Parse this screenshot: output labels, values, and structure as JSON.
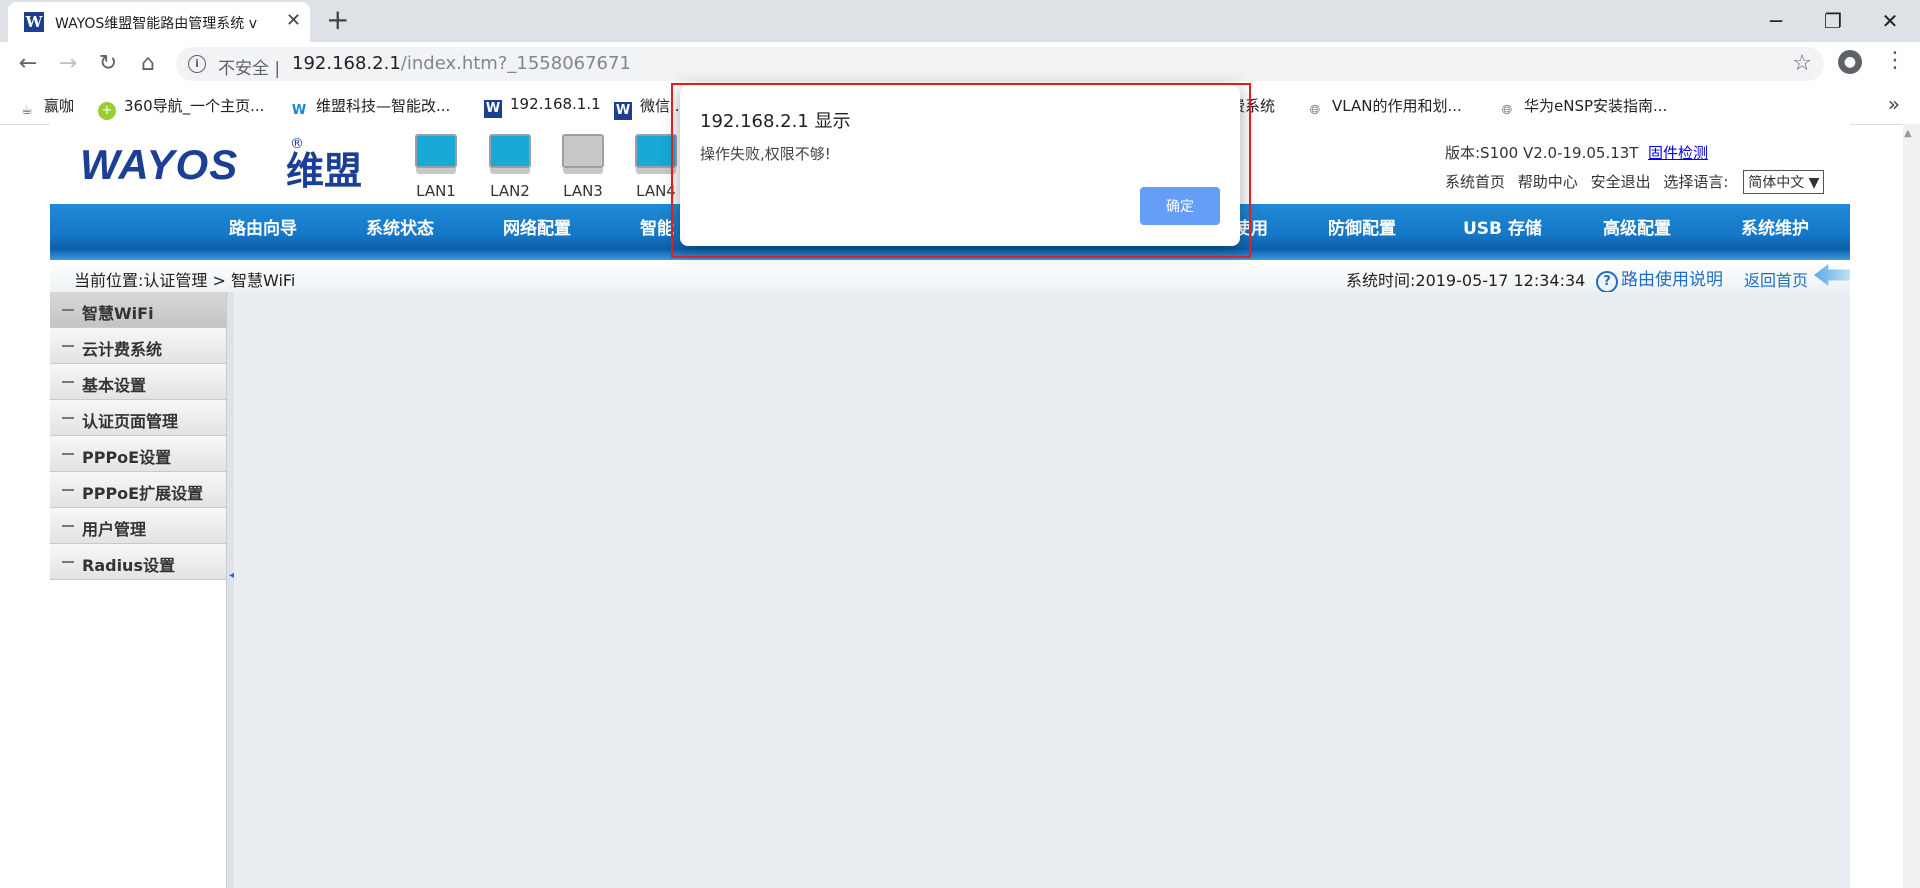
{
  "browser": {
    "tab_title": "WAYOS维盟智能路由管理系统 v",
    "tab_favicon": "W",
    "new_tab_symbol": "+",
    "close_symbol": "✕",
    "window_controls": {
      "minimize": "─",
      "maximize": "❐",
      "close": "✕"
    },
    "nav": {
      "back": "←",
      "forward": "→",
      "reload": "↻",
      "home": "⌂"
    },
    "security_label": "不安全",
    "url_host": "192.168.2.1",
    "url_path": "/index.htm?_1558067671",
    "bookmarks": [
      {
        "label": "赢咖",
        "icon": "coffee-icon"
      },
      {
        "label": "360导航_一个主页...",
        "icon": "360-icon"
      },
      {
        "label": "维盟科技—智能改...",
        "icon": "wayos-icon"
      },
      {
        "label": "192.168.1.1",
        "icon": "wayos-icon"
      },
      {
        "label": "微信...",
        "icon": "wayos-icon"
      },
      {
        "label": "费系统",
        "icon": "page-icon"
      },
      {
        "label": "VLAN的作用和划...",
        "icon": "globe-icon"
      },
      {
        "label": "华为eNSP安装指南...",
        "icon": "globe-icon"
      }
    ],
    "bookmarks_more": "»"
  },
  "header": {
    "logo_text": "WAYOS",
    "logo_cn": "维盟",
    "logo_reg": "®",
    "lan_ports": [
      {
        "label": "LAN1",
        "status": "active",
        "color": "#18a9d8"
      },
      {
        "label": "LAN2",
        "status": "active",
        "color": "#18a9d8"
      },
      {
        "label": "LAN3",
        "status": "inactive",
        "color": "#c8c8c8"
      },
      {
        "label": "LAN4",
        "status": "active",
        "color": "#18a9d8"
      }
    ],
    "version_label": "版本:S100 V2.0-19.05.13T",
    "firmware_check": "固件检测",
    "links": [
      "系统首页",
      "帮助中心",
      "安全退出",
      "选择语言:"
    ],
    "language": "简体中文 ▼"
  },
  "navbar": {
    "items": [
      "路由向导",
      "系统状态",
      "网络配置",
      "智能",
      "使用",
      "防御配置",
      "USB 存储",
      "高级配置",
      "系统维护"
    ]
  },
  "breadcrumb": {
    "text": "当前位置:认证管理 > 智慧WiFi",
    "system_time": "系统时间:2019-05-17 12:34:34",
    "help": "路由使用说明",
    "help_icon": "?",
    "home": "返回首页"
  },
  "sidebar": {
    "items": [
      {
        "label": "智慧WiFi",
        "active": true
      },
      {
        "label": "云计费系统",
        "active": false
      },
      {
        "label": "基本设置",
        "active": false
      },
      {
        "label": "认证页面管理",
        "active": false
      },
      {
        "label": "PPPoE设置",
        "active": false
      },
      {
        "label": "PPPoE扩展设置",
        "active": false
      },
      {
        "label": "用户管理",
        "active": false
      },
      {
        "label": "Radius设置",
        "active": false
      }
    ],
    "collapse_symbol": "◀"
  },
  "dialog": {
    "title": "192.168.2.1 显示",
    "message": "操作失败,权限不够!",
    "ok_label": "确定"
  },
  "colors": {
    "accent_blue": "#1677c7",
    "highlight_red": "#e02020",
    "dialog_button": "#669df6"
  }
}
